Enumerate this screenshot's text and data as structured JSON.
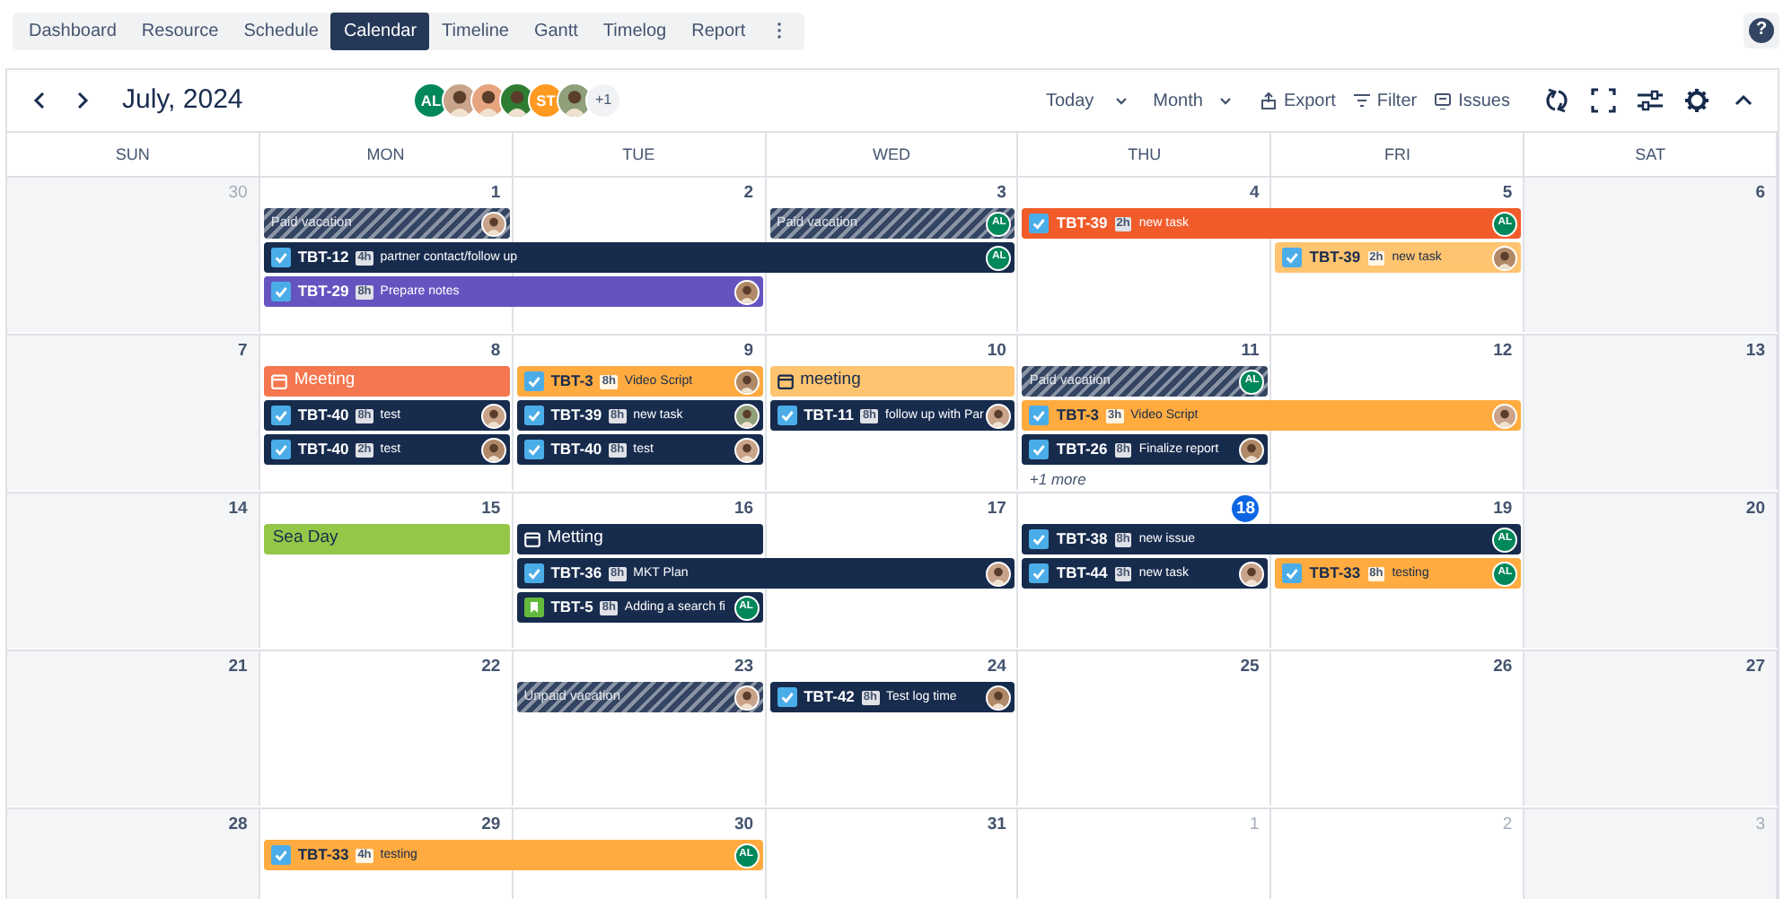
{
  "tabs": [
    {
      "label": "Dashboard",
      "selected": false
    },
    {
      "label": "Resource",
      "selected": false
    },
    {
      "label": "Schedule",
      "selected": false
    },
    {
      "label": "Calendar",
      "selected": true
    },
    {
      "label": "Timeline",
      "selected": false
    },
    {
      "label": "Gantt",
      "selected": false
    },
    {
      "label": "Timelog",
      "selected": false
    },
    {
      "label": "Report",
      "selected": false
    }
  ],
  "more_menu": "⋮",
  "help": "?",
  "toolbar": {
    "title": "July, 2024",
    "people": [
      {
        "kind": "initials",
        "text": "AL",
        "color": "#00875a"
      },
      {
        "kind": "photo",
        "color": "#c9a48a"
      },
      {
        "kind": "photo",
        "color": "#e6a57e"
      },
      {
        "kind": "photo",
        "color": "#2e7d32"
      },
      {
        "kind": "initials",
        "text": "ST",
        "color": "#ff991f"
      },
      {
        "kind": "photo",
        "color": "#8fa07a"
      }
    ],
    "people_more": "+1",
    "today": "Today",
    "view": "Month",
    "export": "Export",
    "filter": "Filter",
    "issues": "Issues"
  },
  "weekdays": [
    "SUN",
    "MON",
    "TUE",
    "WED",
    "THU",
    "FRI",
    "SAT"
  ],
  "weeks": [
    {
      "days": [
        {
          "number": "30",
          "other_month": true,
          "today": false
        },
        {
          "number": "1",
          "other_month": false,
          "today": false,
          "events": [
            {
              "kind": "timeoff",
              "continues": false,
              "label": "Paid vacation",
              "avatar": {
                "kind": "photo",
                "color": "#c9a48a"
              }
            },
            {
              "kind": "task",
              "continues": true,
              "color": "#172b4d",
              "key": "TBT-12",
              "hours": "4h",
              "title": "partner contact/follow up",
              "avatar": {
                "kind": "initials",
                "text": "AL",
                "color": "#00875a"
              }
            },
            {
              "kind": "task",
              "continues": true,
              "color": "#6554c0",
              "key": "TBT-29",
              "hours": "8h",
              "title": "Prepare notes",
              "avatar": {
                "kind": "photo",
                "color": "#b08968"
              }
            }
          ]
        },
        {
          "number": "2",
          "other_month": false,
          "today": false,
          "events": [
            {
              "kind": "continued",
              "continues": true
            },
            {
              "kind": "continued",
              "continues": false
            }
          ]
        },
        {
          "number": "3",
          "other_month": false,
          "today": false,
          "events": [
            {
              "kind": "continued",
              "continues": false
            },
            {
              "kind": "timeoff",
              "continues": false,
              "label": "Paid vacation",
              "avatar": {
                "kind": "initials",
                "text": "AL",
                "color": "#00875a"
              }
            }
          ]
        },
        {
          "number": "4",
          "other_month": false,
          "today": false,
          "events": [
            {
              "kind": "task",
              "continues": true,
              "color": "#f15b2a",
              "key": "TBT-39",
              "hours": "2h",
              "title": "new task",
              "avatar": {
                "kind": "initials",
                "text": "AL",
                "color": "#00875a"
              }
            }
          ]
        },
        {
          "number": "5",
          "other_month": false,
          "today": false,
          "events": [
            {
              "kind": "continued",
              "continues": false
            },
            {
              "kind": "task",
              "continues": false,
              "color": "#ffc470",
              "key": "TBT-39",
              "hours": "2h",
              "title": "new task",
              "avatar": {
                "kind": "photo",
                "color": "#b08968"
              }
            }
          ]
        },
        {
          "number": "6",
          "other_month": false,
          "today": false
        }
      ]
    },
    {
      "days": [
        {
          "number": "7",
          "other_month": false,
          "today": false
        },
        {
          "number": "8",
          "other_month": false,
          "today": false,
          "events": [
            {
              "kind": "meeting",
              "continues": false,
              "color": "#f4774f",
              "title": "Meeting"
            },
            {
              "kind": "task",
              "continues": false,
              "color": "#172b4d",
              "key": "TBT-40",
              "hours": "8h",
              "title": "test",
              "avatar": {
                "kind": "photo",
                "color": "#c9a48a"
              }
            },
            {
              "kind": "task",
              "continues": false,
              "color": "#172b4d",
              "key": "TBT-40",
              "hours": "2h",
              "title": "test",
              "avatar": {
                "kind": "photo",
                "color": "#b08968"
              }
            }
          ]
        },
        {
          "number": "9",
          "other_month": false,
          "today": false,
          "events": [
            {
              "kind": "task",
              "continues": false,
              "color": "#ffab40",
              "key": "TBT-3",
              "hours": "8h",
              "title": "Video Script",
              "avatar": {
                "kind": "photo",
                "color": "#b08968"
              }
            },
            {
              "kind": "task",
              "continues": false,
              "color": "#172b4d",
              "key": "TBT-39",
              "hours": "8h",
              "title": "new task",
              "avatar": {
                "kind": "photo",
                "color": "#8fa07a"
              }
            },
            {
              "kind": "task",
              "continues": false,
              "color": "#172b4d",
              "key": "TBT-40",
              "hours": "8h",
              "title": "test",
              "avatar": {
                "kind": "photo",
                "color": "#c9a48a"
              }
            }
          ]
        },
        {
          "number": "10",
          "other_month": false,
          "today": false,
          "events": [
            {
              "kind": "meeting",
              "continues": false,
              "color": "#ffc470",
              "title": "meeting"
            },
            {
              "kind": "task",
              "continues": false,
              "color": "#172b4d",
              "key": "TBT-11",
              "hours": "8h",
              "title": "follow up with Par",
              "avatar": {
                "kind": "photo",
                "color": "#c9a48a"
              }
            }
          ]
        },
        {
          "number": "11",
          "other_month": false,
          "today": false,
          "more": "+1 more",
          "events": [
            {
              "kind": "timeoff",
              "continues": false,
              "label": "Paid vacation",
              "avatar": {
                "kind": "initials",
                "text": "AL",
                "color": "#00875a"
              }
            },
            {
              "kind": "task",
              "continues": true,
              "color": "#ffab40",
              "key": "TBT-3",
              "hours": "3h",
              "title": "Video Script",
              "avatar": {
                "kind": "photo",
                "color": "#c9a48a"
              }
            },
            {
              "kind": "task",
              "continues": false,
              "color": "#172b4d",
              "key": "TBT-26",
              "hours": "8h",
              "title": "Finalize report",
              "avatar": {
                "kind": "photo",
                "color": "#b08968"
              }
            }
          ]
        },
        {
          "number": "12",
          "other_month": false,
          "today": false,
          "events": [
            {
              "kind": "continued",
              "continues": false
            }
          ]
        },
        {
          "number": "13",
          "other_month": false,
          "today": false
        }
      ]
    },
    {
      "days": [
        {
          "number": "14",
          "other_month": false,
          "today": false
        },
        {
          "number": "15",
          "other_month": false,
          "today": false,
          "events": [
            {
              "kind": "holiday",
              "continues": false,
              "color": "#94c748",
              "title": "Sea Day"
            }
          ]
        },
        {
          "number": "16",
          "other_month": false,
          "today": false,
          "events": [
            {
              "kind": "meeting",
              "continues": false,
              "color": "#172b4d",
              "title": "Metting"
            },
            {
              "kind": "task",
              "continues": true,
              "color": "#172b4d",
              "key": "TBT-36",
              "hours": "8h",
              "title": "MKT Plan",
              "avatar": {
                "kind": "photo",
                "color": "#c9a48a"
              }
            },
            {
              "kind": "story",
              "continues": false,
              "color": "#172b4d",
              "key": "TBT-5",
              "hours": "8h",
              "title": "Adding a search fi",
              "avatar": {
                "kind": "initials",
                "text": "AL",
                "color": "#00875a"
              }
            }
          ]
        },
        {
          "number": "17",
          "other_month": false,
          "today": false,
          "events": [
            {
              "kind": "continued",
              "continues": false
            }
          ]
        },
        {
          "number": "18",
          "other_month": false,
          "today": true,
          "events": [
            {
              "kind": "task",
              "continues": true,
              "color": "#172b4d",
              "key": "TBT-38",
              "hours": "8h",
              "title": "new issue",
              "avatar": {
                "kind": "initials",
                "text": "AL",
                "color": "#00875a"
              }
            },
            {
              "kind": "task",
              "continues": false,
              "color": "#172b4d",
              "key": "TBT-44",
              "hours": "3h",
              "title": "new task",
              "avatar": {
                "kind": "photo",
                "color": "#c9a48a"
              }
            }
          ]
        },
        {
          "number": "19",
          "other_month": false,
          "today": false,
          "events": [
            {
              "kind": "continued",
              "continues": false
            },
            {
              "kind": "task",
              "continues": false,
              "color": "#ffab40",
              "key": "TBT-33",
              "hours": "8h",
              "title": "testing",
              "avatar": {
                "kind": "initials",
                "text": "AL",
                "color": "#00875a"
              }
            }
          ]
        },
        {
          "number": "20",
          "other_month": false,
          "today": false
        }
      ]
    },
    {
      "days": [
        {
          "number": "21",
          "other_month": false,
          "today": false
        },
        {
          "number": "22",
          "other_month": false,
          "today": false
        },
        {
          "number": "23",
          "other_month": false,
          "today": false,
          "events": [
            {
              "kind": "timeoff",
              "continues": false,
              "label": "Unpaid vacation",
              "avatar": {
                "kind": "photo",
                "color": "#c9a48a"
              }
            }
          ]
        },
        {
          "number": "24",
          "other_month": false,
          "today": false,
          "events": [
            {
              "kind": "task",
              "continues": false,
              "color": "#172b4d",
              "key": "TBT-42",
              "hours": "8h",
              "title": "Test log time",
              "avatar": {
                "kind": "photo",
                "color": "#b08968"
              }
            }
          ]
        },
        {
          "number": "25",
          "other_month": false,
          "today": false
        },
        {
          "number": "26",
          "other_month": false,
          "today": false
        },
        {
          "number": "27",
          "other_month": false,
          "today": false
        }
      ]
    },
    {
      "days": [
        {
          "number": "28",
          "other_month": false,
          "today": false
        },
        {
          "number": "29",
          "other_month": false,
          "today": false,
          "events": [
            {
              "kind": "task",
              "continues": true,
              "color": "#ffab40",
              "key": "TBT-33",
              "hours": "4h",
              "title": "testing",
              "avatar": {
                "kind": "initials",
                "text": "AL",
                "color": "#00875a"
              }
            }
          ]
        },
        {
          "number": "30",
          "other_month": false,
          "today": false,
          "events": [
            {
              "kind": "continued",
              "continues": false
            }
          ]
        },
        {
          "number": "31",
          "other_month": false,
          "today": false
        },
        {
          "number": "1",
          "other_month": true,
          "today": false
        },
        {
          "number": "2",
          "other_month": true,
          "today": false
        },
        {
          "number": "3",
          "other_month": true,
          "today": false
        }
      ]
    }
  ]
}
